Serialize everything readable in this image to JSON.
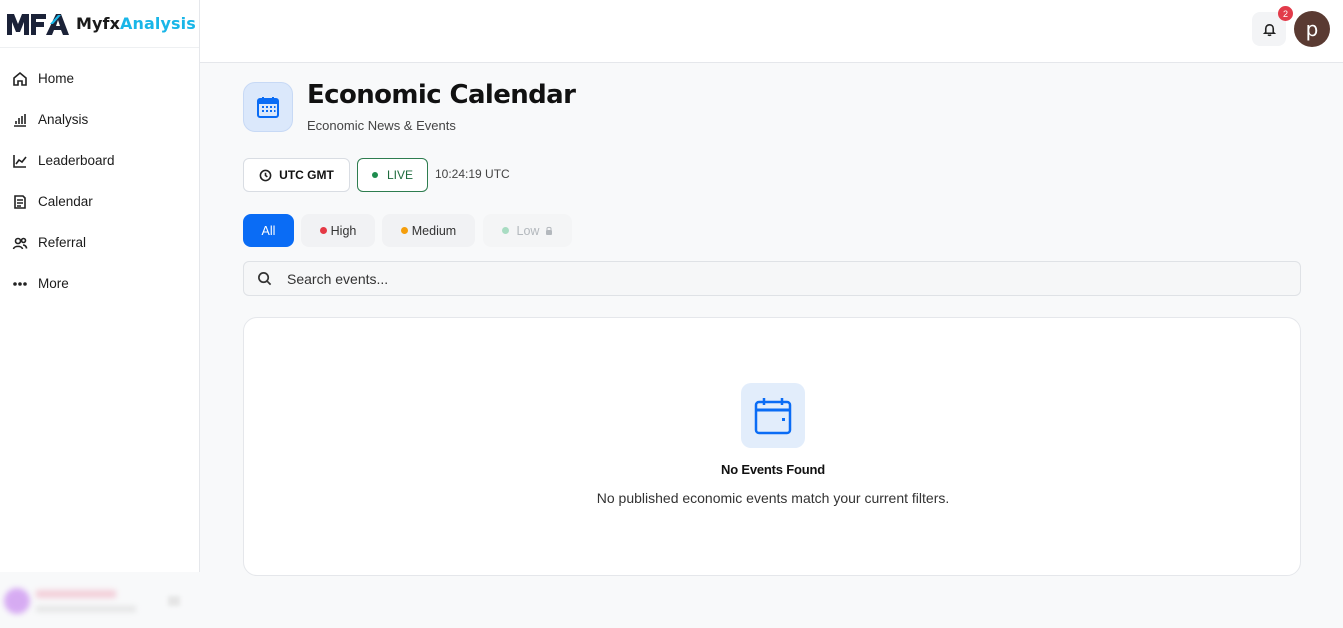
{
  "brand": {
    "name_part1": "Myfx",
    "name_part2": "Analysis",
    "accent": "#19b6e8"
  },
  "sidebar": {
    "items": [
      {
        "label": "Home",
        "icon": "home-icon"
      },
      {
        "label": "Analysis",
        "icon": "bar-chart-icon"
      },
      {
        "label": "Leaderboard",
        "icon": "trend-line-icon"
      },
      {
        "label": "Calendar",
        "icon": "calendar-list-icon"
      },
      {
        "label": "Referral",
        "icon": "users-icon"
      },
      {
        "label": "More",
        "icon": "more-dots-icon"
      }
    ]
  },
  "header": {
    "notification_count": "2",
    "avatar_initial": "p"
  },
  "page": {
    "title": "Economic Calendar",
    "subtitle": "Economic News & Events"
  },
  "time": {
    "timezone_label": "UTC GMT",
    "live_label": "LIVE",
    "clock": "10:24:19 UTC"
  },
  "filters": {
    "all": "All",
    "high": "High",
    "medium": "Medium",
    "low": "Low",
    "active": "All"
  },
  "search": {
    "placeholder": "Search events..."
  },
  "empty": {
    "title": "No Events Found",
    "message": "No published economic events match your current filters."
  },
  "colors": {
    "primary": "#0a6cf5",
    "high": "#e53945",
    "medium": "#f59e0b",
    "low": "#a8dcc2",
    "live": "#1e8c4e",
    "badge": "#e23b4a"
  }
}
